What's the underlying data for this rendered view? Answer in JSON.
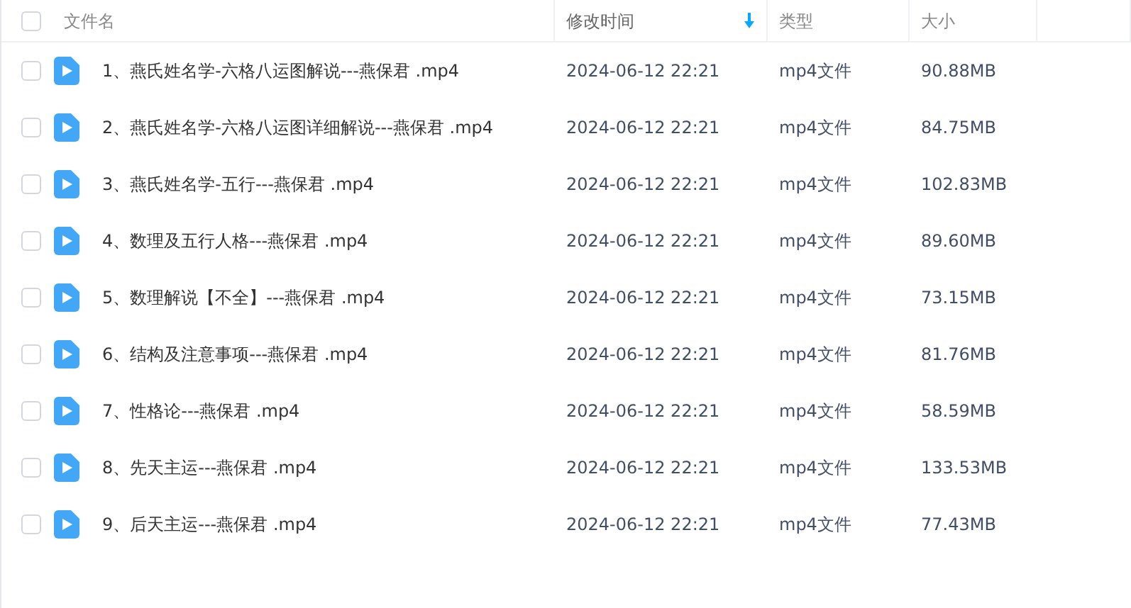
{
  "columns": [
    {
      "label": "文件名",
      "sorted": false
    },
    {
      "label": "修改时间",
      "sorted": true
    },
    {
      "label": "类型",
      "sorted": false
    },
    {
      "label": "大小",
      "sorted": false
    }
  ],
  "select_all": {
    "checked": false
  },
  "files": [
    {
      "name": "1、燕氏姓名学-六格八运图解说---燕保君 .mp4",
      "modified": "2024-06-12 22:21",
      "type": "mp4文件",
      "size": "90.88MB",
      "checked": false
    },
    {
      "name": "2、燕氏姓名学-六格八运图详细解说---燕保君 .mp4",
      "modified": "2024-06-12 22:21",
      "type": "mp4文件",
      "size": "84.75MB",
      "checked": false
    },
    {
      "name": "3、燕氏姓名学-五行---燕保君 .mp4",
      "modified": "2024-06-12 22:21",
      "type": "mp4文件",
      "size": "102.83MB",
      "checked": false
    },
    {
      "name": "4、数理及五行人格---燕保君 .mp4",
      "modified": "2024-06-12 22:21",
      "type": "mp4文件",
      "size": "89.60MB",
      "checked": false
    },
    {
      "name": "5、数理解说【不全】---燕保君 .mp4",
      "modified": "2024-06-12 22:21",
      "type": "mp4文件",
      "size": "73.15MB",
      "checked": false
    },
    {
      "name": "6、结构及注意事项---燕保君 .mp4",
      "modified": "2024-06-12 22:21",
      "type": "mp4文件",
      "size": "81.76MB",
      "checked": false
    },
    {
      "name": "7、性格论---燕保君 .mp4",
      "modified": "2024-06-12 22:21",
      "type": "mp4文件",
      "size": "58.59MB",
      "checked": false
    },
    {
      "name": "8、先天主运---燕保君 .mp4",
      "modified": "2024-06-12 22:21",
      "type": "mp4文件",
      "size": "133.53MB",
      "checked": false
    },
    {
      "name": "9、后天主运---燕保君 .mp4",
      "modified": "2024-06-12 22:21",
      "type": "mp4文件",
      "size": "77.43MB",
      "checked": false
    }
  ]
}
